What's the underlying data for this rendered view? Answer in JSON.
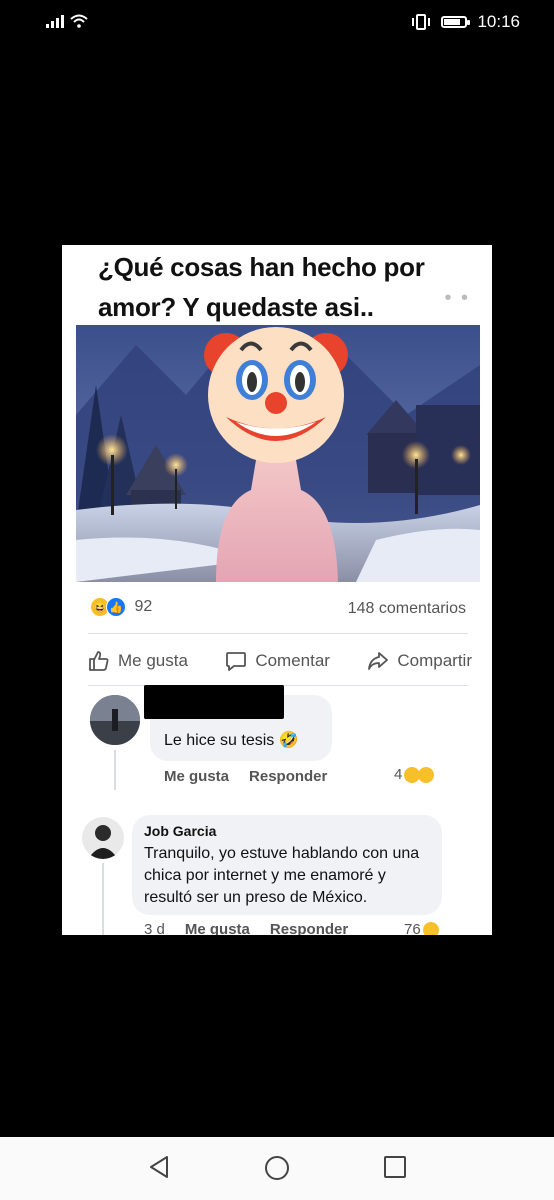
{
  "status_bar": {
    "time": "10:16",
    "icons": [
      "signal-icon",
      "wifi-icon",
      "vibrate-icon",
      "battery-icon"
    ]
  },
  "post": {
    "title": "¿Qué cosas han hecho por amor? Y quedaste asi..",
    "more_label": "• •",
    "image_icon": "clown-emoji",
    "reactions": {
      "count": "92",
      "icons": [
        "haha-reaction",
        "like-reaction"
      ]
    },
    "comments_count": "148 comentarios",
    "actions": {
      "like": "Me gusta",
      "comment": "Comentar",
      "share": "Compartir"
    }
  },
  "comments": [
    {
      "text": "Le hice su tesis",
      "emoji": "🤣",
      "like_label": "Me gusta",
      "reply_label": "Responder",
      "reaction_count": "4"
    },
    {
      "author": "Job Garcia",
      "text": "Tranquilo, yo estuve hablando con una chica por internet y me enamoré y resultó ser un preso de México.",
      "time": "3 d",
      "like_label": "Me gusta",
      "reply_label": "Responder",
      "reaction_count": "76"
    }
  ],
  "colors": {
    "like_blue": "#1877f2",
    "bubble": "#f0f2f5",
    "haha_yellow": "#f7c02b"
  }
}
